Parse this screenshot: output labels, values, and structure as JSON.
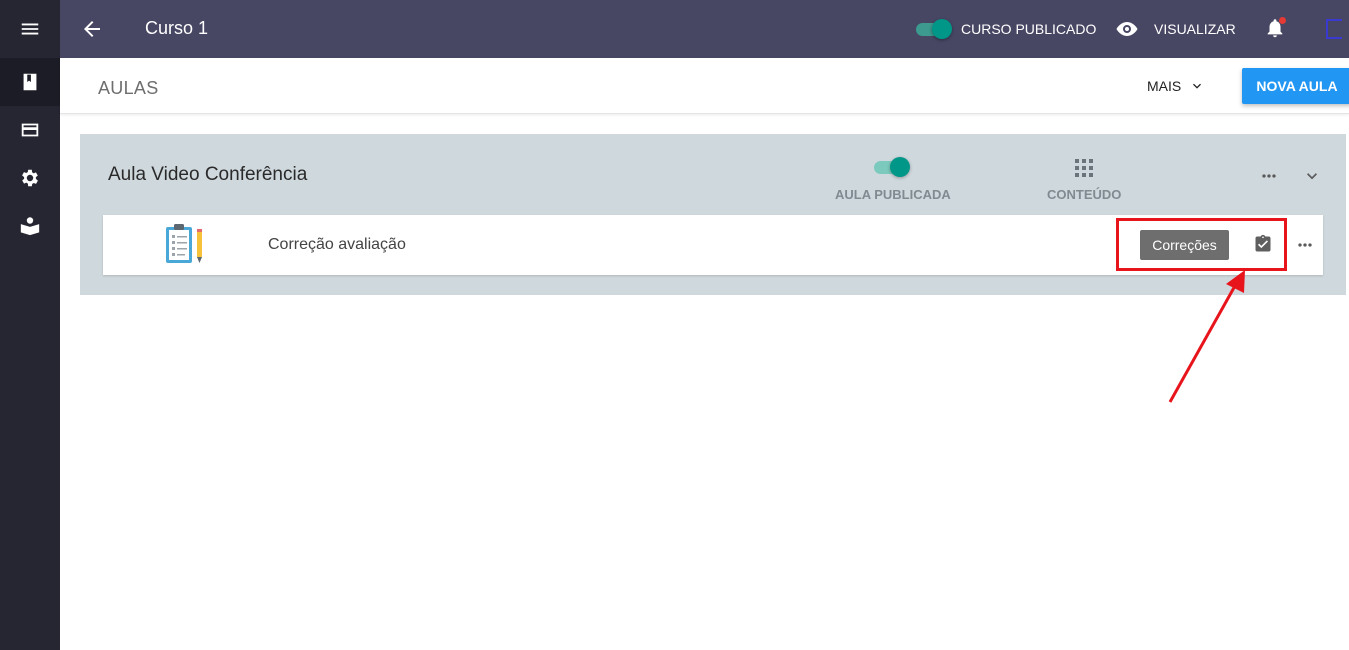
{
  "topbar": {
    "course_title": "Curso 1",
    "published_label": "CURSO PUBLICADO",
    "view_label": "VISUALIZAR"
  },
  "subheader": {
    "section_title": "AULAS",
    "more_label": "MAIS",
    "new_lesson_label": "NOVA AULA"
  },
  "lesson": {
    "title": "Aula Video Conferência",
    "published_label": "AULA PUBLICADA",
    "content_label": "CONTEÚDO",
    "published": true,
    "items": [
      {
        "title": "Correção avaliação",
        "tag": "Correções"
      }
    ]
  },
  "colors": {
    "rail": "#262632",
    "topbar": "#474764",
    "primary": "#2196f3",
    "toggle": "#009688",
    "lesson_bg": "#cfd8dd",
    "annotation": "#e8141c"
  },
  "icons": {
    "rail": [
      "menu-icon",
      "book-icon",
      "credit-card-icon",
      "gear-icon",
      "reader-icon"
    ],
    "topbar": [
      "arrow-back-icon",
      "eye-icon",
      "bell-icon"
    ]
  }
}
